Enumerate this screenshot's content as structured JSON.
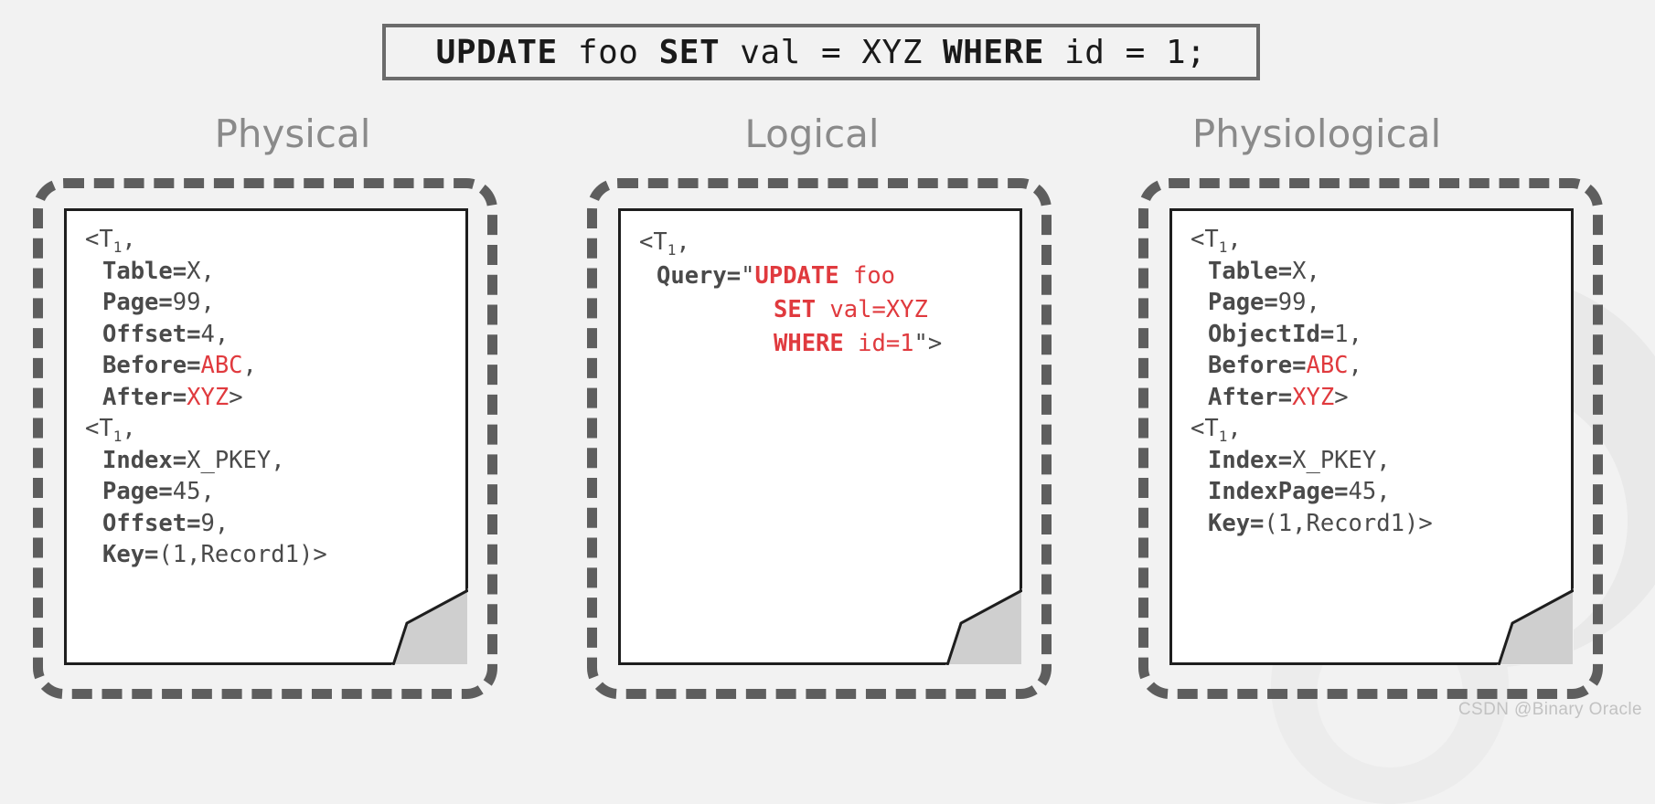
{
  "sql_banner": {
    "parts": [
      {
        "text": "UPDATE",
        "bold": true
      },
      {
        "text": " foo ",
        "bold": false
      },
      {
        "text": "SET",
        "bold": true
      },
      {
        "text": " val = XYZ ",
        "bold": false
      },
      {
        "text": "WHERE",
        "bold": true
      },
      {
        "text": " id = 1;",
        "bold": false
      }
    ],
    "full_text": "UPDATE foo SET val = XYZ WHERE id = 1;"
  },
  "columns": [
    {
      "heading": "Physical",
      "records": [
        {
          "open": "<T",
          "open_sub": "1",
          "open_tail": ",",
          "fields": [
            {
              "label": "Table",
              "value": "X",
              "value_color": "gray",
              "tail": ","
            },
            {
              "label": "Page",
              "value": "99",
              "value_color": "gray",
              "tail": ","
            },
            {
              "label": "Offset",
              "value": "4",
              "value_color": "gray",
              "tail": ","
            },
            {
              "label": "Before",
              "value": "ABC",
              "value_color": "red",
              "tail": ","
            },
            {
              "label": "After",
              "value": "XYZ",
              "value_color": "red",
              "tail": ">"
            }
          ]
        },
        {
          "open": "<T",
          "open_sub": "1",
          "open_tail": ",",
          "fields": [
            {
              "label": "Index",
              "value": "X_PKEY",
              "value_color": "gray",
              "tail": ","
            },
            {
              "label": "Page",
              "value": "45",
              "value_color": "gray",
              "tail": ","
            },
            {
              "label": "Offset",
              "value": "9",
              "value_color": "gray",
              "tail": ","
            },
            {
              "label": "Key",
              "value": "(1,Record1)",
              "value_color": "gray",
              "tail": ">"
            }
          ]
        }
      ]
    },
    {
      "heading": "Logical",
      "query_record": {
        "open": "<T",
        "open_sub": "1",
        "open_tail": ",",
        "label": "Query",
        "quote_open": "\"",
        "quote_close": "\">",
        "query_lines": [
          [
            {
              "text": "UPDATE",
              "bold": true
            },
            {
              "text": " foo",
              "bold": false
            }
          ],
          [
            {
              "text": "SET",
              "bold": true
            },
            {
              "text": " val=XYZ",
              "bold": false
            }
          ],
          [
            {
              "text": "WHERE",
              "bold": true
            },
            {
              "text": " id=1",
              "bold": false
            }
          ]
        ]
      }
    },
    {
      "heading": "Physiological",
      "records": [
        {
          "open": "<T",
          "open_sub": "1",
          "open_tail": ",",
          "fields": [
            {
              "label": "Table",
              "value": "X",
              "value_color": "gray",
              "tail": ","
            },
            {
              "label": "Page",
              "value": "99",
              "value_color": "gray",
              "tail": ","
            },
            {
              "label": "ObjectId",
              "value": "1",
              "value_color": "gray",
              "tail": ","
            },
            {
              "label": "Before",
              "value": "ABC",
              "value_color": "red",
              "tail": ","
            },
            {
              "label": "After",
              "value": "XYZ",
              "value_color": "red",
              "tail": ">"
            }
          ]
        },
        {
          "open": "<T",
          "open_sub": "1",
          "open_tail": ",",
          "fields": [
            {
              "label": "Index",
              "value": "X_PKEY",
              "value_color": "gray",
              "tail": ","
            },
            {
              "label": "IndexPage",
              "value": "45",
              "value_color": "gray",
              "tail": ","
            },
            {
              "label": "Key",
              "value": "(1,Record1)",
              "value_color": "gray",
              "tail": ">"
            }
          ]
        }
      ]
    }
  ],
  "watermark": "CSDN @Binary Oracle",
  "colors": {
    "accent_red": "#e03a3e",
    "text_gray": "#4a4a4a",
    "heading_gray": "#8a8a8a",
    "dash_gray": "#5e5e5e",
    "background": "#f2f2f2"
  }
}
